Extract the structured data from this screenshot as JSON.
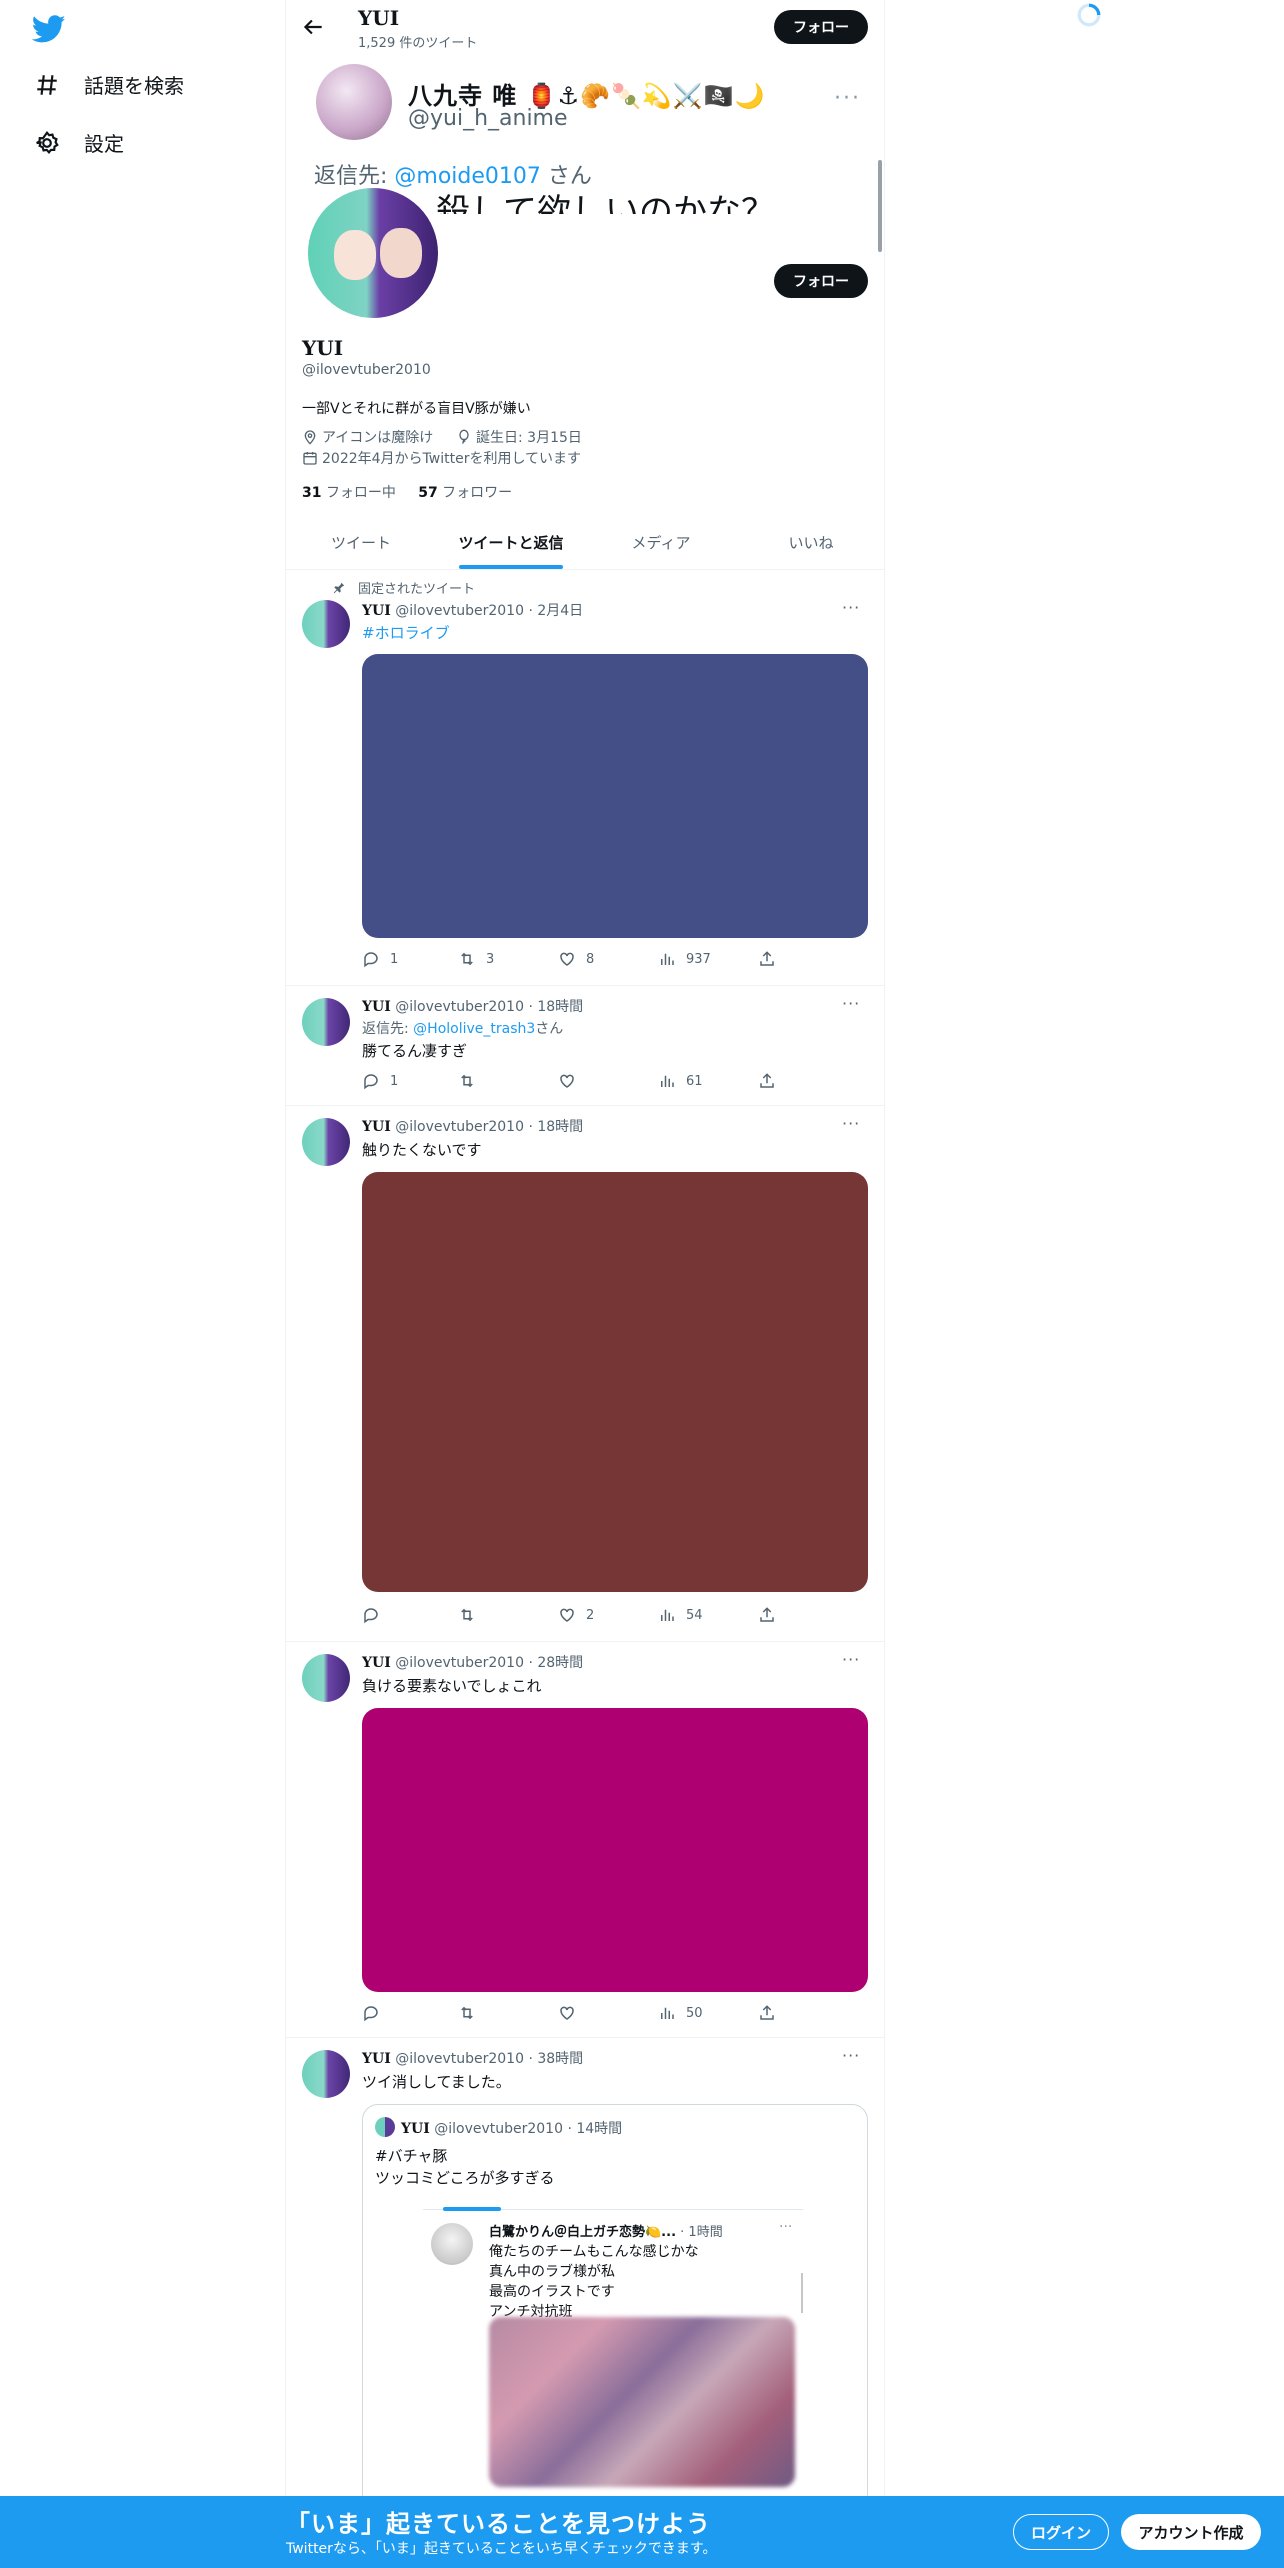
{
  "nav": {
    "logo": "twitter-bird-icon",
    "items": [
      {
        "label": "話題を検索",
        "icon": "hashtag-icon"
      },
      {
        "label": "設定",
        "icon": "gear-icon"
      }
    ]
  },
  "header": {
    "name": "YUI",
    "tweet_count": "1,529 件のツイート",
    "follow_label": "フォロー"
  },
  "banner": {
    "name": "八九寺 唯 🏮⚓🥐🍡💫⚔️🏴‍☠️🌙",
    "handle": "@yui_h_anime",
    "more": "···",
    "reply_prefix": "返信先: ",
    "reply_link": "@moide0107",
    "reply_suffix": " さん",
    "text": "殺して欲しいのかな？"
  },
  "profile": {
    "name": "YUI",
    "handle": "@ilovevtuber2010",
    "follow_label": "フォロー",
    "bio": "一部Vとそれに群がる盲目V豚が嫌い",
    "location": "アイコンは魔除け",
    "birthday": "誕生日: 3月15日",
    "joined": "2022年4月からTwitterを利用しています",
    "following_count": "31",
    "following_label": "フォロー中",
    "followers_count": "57",
    "followers_label": "フォロワー"
  },
  "tabs": [
    "ツイート",
    "ツイートと返信",
    "メディア",
    "いいね"
  ],
  "active_tab": 1,
  "pinned_label": "固定されたツイート",
  "tweets": [
    {
      "name": "YUI",
      "handle": "@ilovevtuber2010",
      "time": "2月4日",
      "text": "#ホロライブ",
      "media_color": "#434f86",
      "reply": "1",
      "retweet": "3",
      "like": "8",
      "views": "937"
    },
    {
      "name": "YUI",
      "handle": "@ilovevtuber2010",
      "time": "18時間",
      "reply_prefix": "返信先: ",
      "reply_link": "@Hololive_trash3",
      "reply_suffix": "さん",
      "text": "勝てるん凄すぎ",
      "reply": "1",
      "retweet": "",
      "like": "",
      "views": "61"
    },
    {
      "name": "YUI",
      "handle": "@ilovevtuber2010",
      "time": "18時間",
      "text": "触りたくないです",
      "media_color": "#763636",
      "reply": "",
      "retweet": "",
      "like": "2",
      "views": "54"
    },
    {
      "name": "YUI",
      "handle": "@ilovevtuber2010",
      "time": "28時間",
      "text": "負ける要素ないでしょこれ",
      "media_color": "#ae0070",
      "reply": "",
      "retweet": "",
      "like": "",
      "views": "50"
    },
    {
      "name": "YUI",
      "handle": "@ilovevtuber2010",
      "time": "38時間",
      "text": "ツイ消ししてました。",
      "quote": {
        "name": "YUI",
        "handle": "@ilovevtuber2010",
        "time": "14時間",
        "line1": "#バチャ豚",
        "line2": "ツッコミどころが多すぎる",
        "inner": {
          "name": "白鷺かりん＠白上ガチ恋勢🍋...",
          "time": "1時間",
          "lines": [
            "俺たちのチームもこんな感じかな",
            "真ん中のラブ様が私",
            "最高のイラストです",
            "アンチ対抗班"
          ]
        }
      }
    }
  ],
  "bottom": {
    "title": "「いま」起きていることを見つけよう",
    "subtitle": "Twitterなら、「いま」起きていることをいち早くチェックできます。",
    "login": "ログイン",
    "signup": "アカウント作成"
  },
  "colors": {
    "accent": "#1d9bf0",
    "text": "#0f1419",
    "muted": "#536471"
  }
}
